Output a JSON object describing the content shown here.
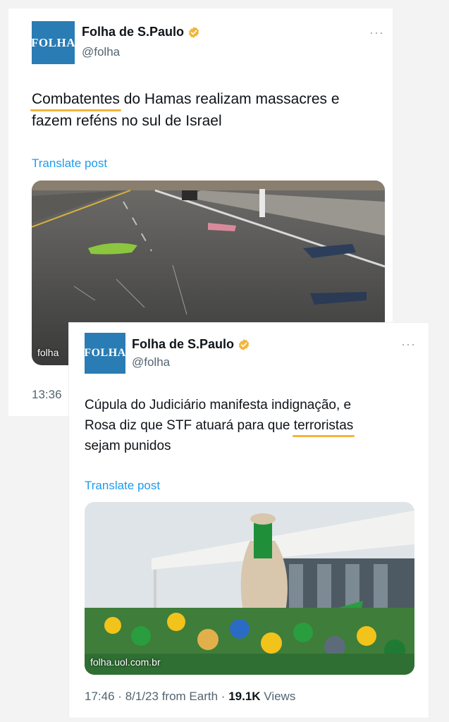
{
  "tweet1": {
    "logo_text": "FOLHA",
    "display_name": "Folha de S.Paulo",
    "handle": "@folha",
    "more": "···",
    "text_highlight": "Combatentes",
    "text_line1_rest": " do Hamas realizam massacres e",
    "text_line2": "fazem reféns no sul de Israel",
    "translate": "Translate post",
    "media_caption": "folha",
    "time": "13:36"
  },
  "tweet2": {
    "logo_text": "FOLHA",
    "display_name": "Folha de S.Paulo",
    "handle": "@folha",
    "more": "···",
    "text_line1": "Cúpula do Judiciário manifesta indignação, e",
    "text_line2_before": "Rosa diz que STF atuará para que ",
    "text_highlight": "terroristas",
    "text_line3": "sejam punidos",
    "translate": "Translate post",
    "media_caption": "folha.uol.com.br",
    "time": "17:46",
    "date": "8/1/23",
    "source": "from Earth",
    "views_count": "19.1K",
    "views_label": "Views"
  },
  "colors": {
    "brand_blue": "#2a7cb4",
    "verified_gold": "#f2b53a",
    "link_blue": "#1d9bf0",
    "highlight_underline": "#f2b53a"
  },
  "icons": {
    "verified": "verified-badge-icon",
    "more": "more-options-icon"
  }
}
